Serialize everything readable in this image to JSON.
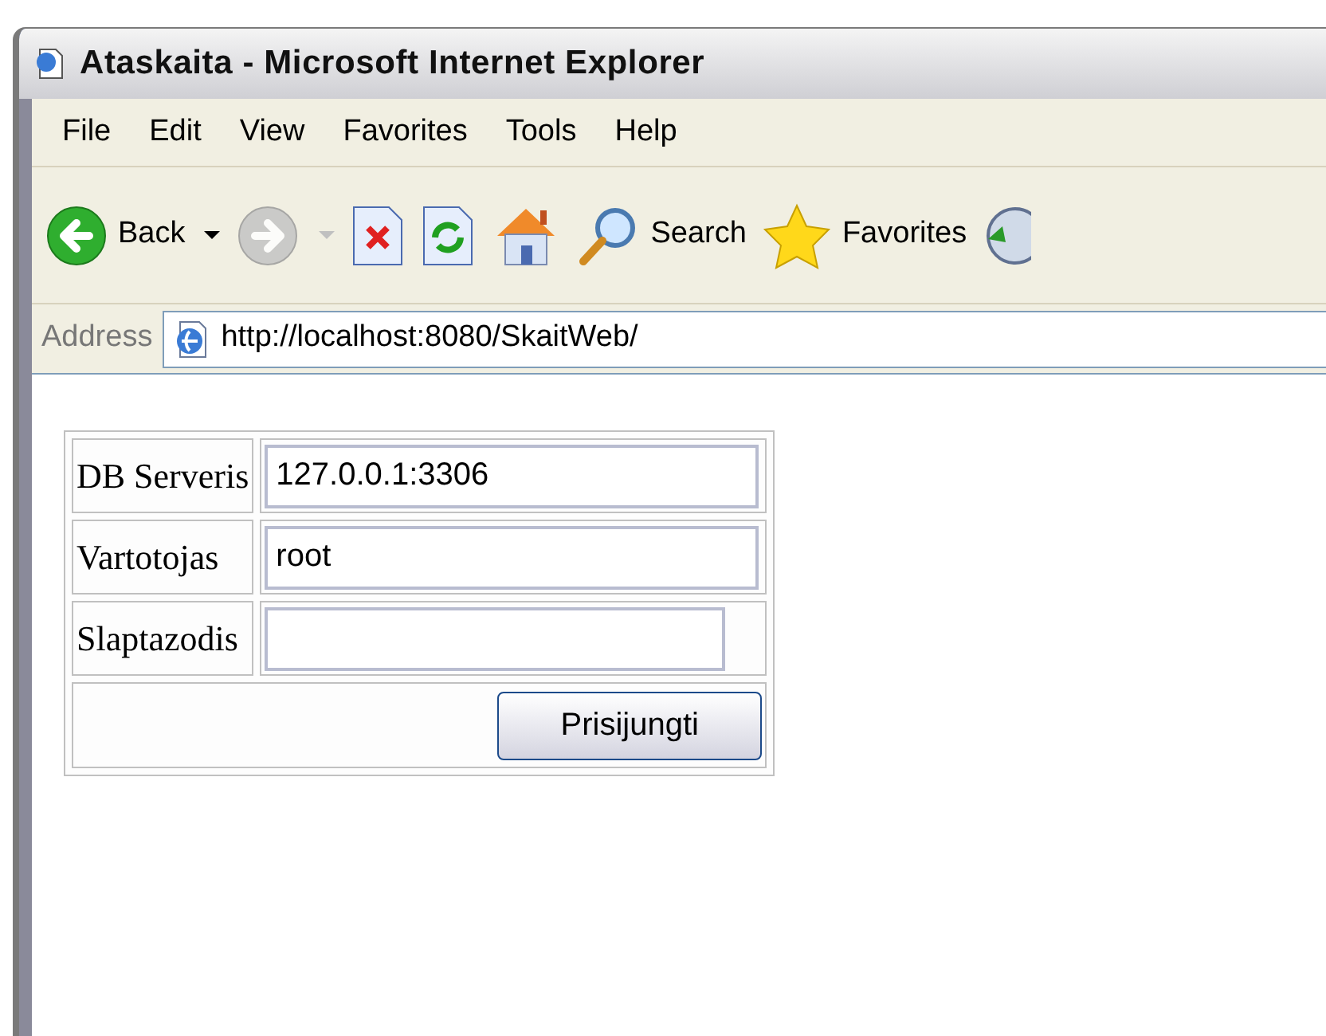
{
  "window": {
    "title": "Ataskaita - Microsoft Internet Explorer"
  },
  "menu": [
    "File",
    "Edit",
    "View",
    "Favorites",
    "Tools",
    "Help"
  ],
  "toolbar": [
    {
      "kind": "back",
      "label": "Back",
      "disabled": false
    },
    {
      "kind": "forward",
      "disabled": true
    },
    {
      "kind": "stop",
      "disabled": false
    },
    {
      "kind": "refresh",
      "disabled": false
    },
    {
      "kind": "home",
      "disabled": false
    },
    {
      "kind": "search",
      "label": "Search",
      "disabled": false
    },
    {
      "kind": "favorites",
      "label": "Favorites",
      "disabled": false
    },
    {
      "kind": "history",
      "disabled": false
    }
  ],
  "address": {
    "label": "Address",
    "url": "http://localhost:8080/SkaitWeb/"
  },
  "form": {
    "fields": [
      {
        "label": "DB Serveris",
        "value": "127.0.0.1:3306",
        "kind": "text"
      },
      {
        "label": "Vartotojas",
        "value": "root",
        "kind": "text"
      },
      {
        "label": "Slaptazodis",
        "kind": "password"
      }
    ],
    "submit": "Prisijungti"
  }
}
